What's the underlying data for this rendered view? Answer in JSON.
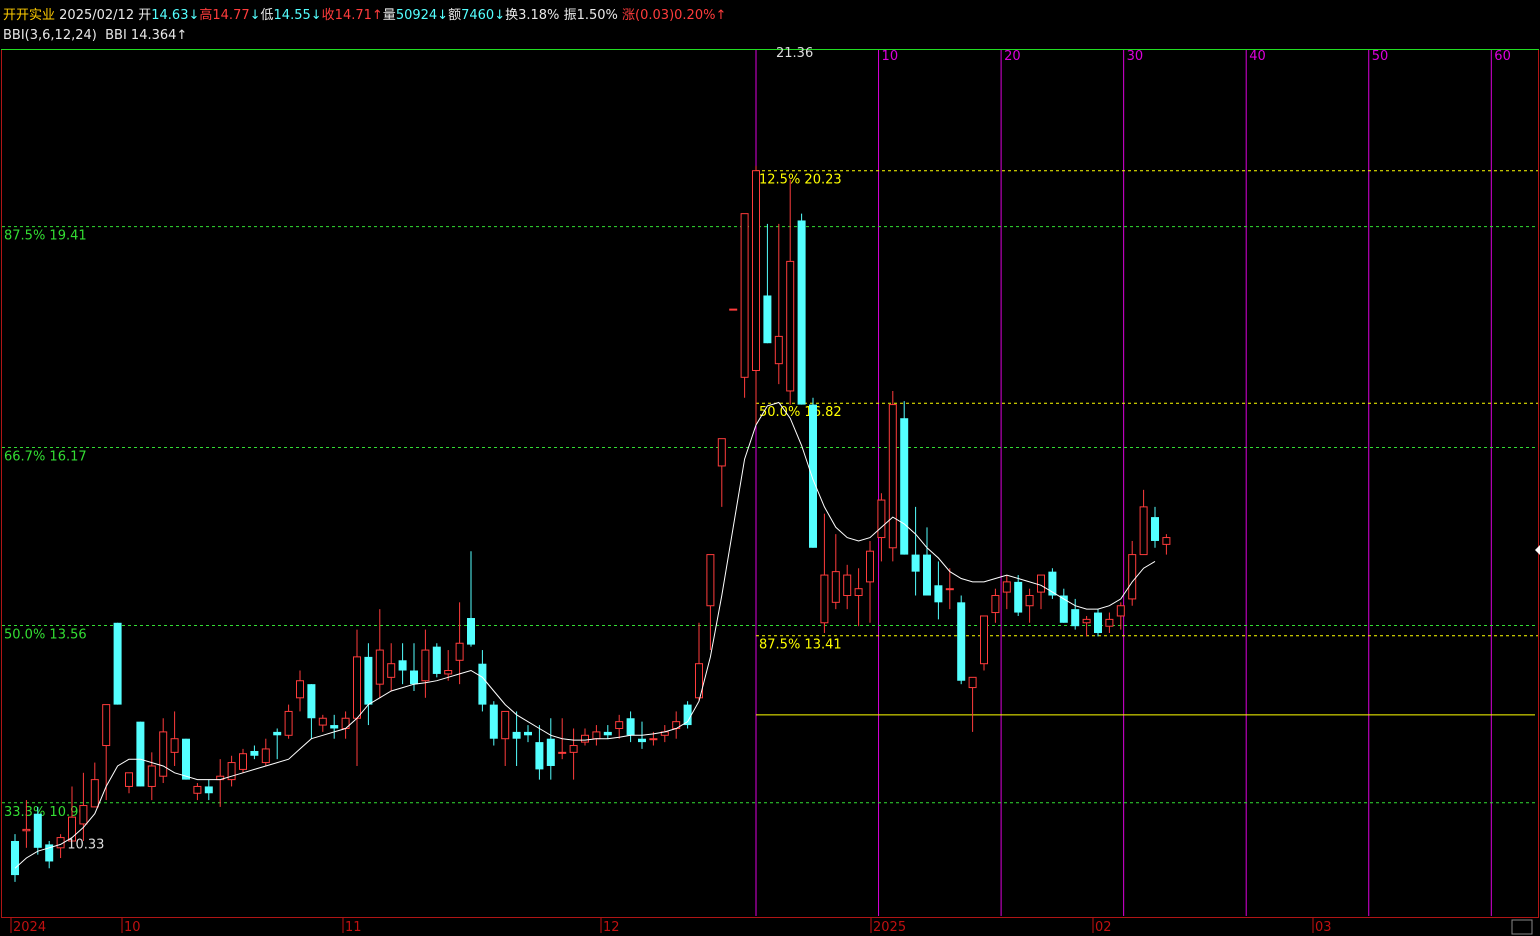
{
  "header": {
    "stock_name": "开开实业",
    "date": "2025/02/12",
    "open_label": "开",
    "open_value": "14.63",
    "open_arrow": "↓",
    "high_label": "高",
    "high_value": "14.77",
    "high_arrow": "↓",
    "low_label": "低",
    "low_value": "14.55",
    "low_arrow": "↓",
    "close_label": "收",
    "close_value": "14.71",
    "close_arrow": "↑",
    "volume_label": "量",
    "volume_value": "50924",
    "volume_arrow": "↓",
    "amount_label": "额",
    "amount_value": "7460",
    "amount_arrow": "↓",
    "turnover_label": "换",
    "turnover_value": "3.18%",
    "amplitude_label": "振",
    "amplitude_value": "1.50%",
    "change_label": "涨",
    "change_value": "(0.03)",
    "change_pct": "0.20%",
    "change_arrow": "↑"
  },
  "indicator": {
    "name": "BBI(3,6,12,24)",
    "series_label": "BBI",
    "value": "14.364",
    "arrow": "↑"
  },
  "colors": {
    "up": "#ff3c3c",
    "down": "#54ffff",
    "bbi_line": "#ffffff",
    "ratio_left": "#33dd33",
    "ratio_right": "#ffff00",
    "time_cycle": "#dd00dd",
    "axis_red": "#c01010",
    "text_yellow": "#ffcc00"
  },
  "chart_data": {
    "type": "candlestick",
    "y_range": [
      9.3,
      22.0
    ],
    "price_markers": {
      "high_marker": "21.36",
      "low_marker": "10.33"
    },
    "candles": [
      [
        10.4,
        10.5,
        9.8,
        9.9
      ],
      [
        10.55,
        11.0,
        10.3,
        10.57
      ],
      [
        10.8,
        10.9,
        10.2,
        10.3
      ],
      [
        10.35,
        10.4,
        10.0,
        10.1
      ],
      [
        10.3,
        10.5,
        10.15,
        10.45
      ],
      [
        10.4,
        11.2,
        10.4,
        10.75
      ],
      [
        10.65,
        11.4,
        10.4,
        10.92
      ],
      [
        10.9,
        11.55,
        10.9,
        11.3
      ],
      [
        11.8,
        12.4,
        11.0,
        12.4
      ],
      [
        13.6,
        13.6,
        12.4,
        12.4
      ],
      [
        11.2,
        11.4,
        11.1,
        11.4
      ],
      [
        12.15,
        12.15,
        11.2,
        11.2
      ],
      [
        11.2,
        11.7,
        11.0,
        11.5
      ],
      [
        11.35,
        12.2,
        11.25,
        12.0
      ],
      [
        11.7,
        12.3,
        11.5,
        11.9
      ],
      [
        11.9,
        11.9,
        11.3,
        11.3
      ],
      [
        11.1,
        11.25,
        11.0,
        11.2
      ],
      [
        11.2,
        11.3,
        11.0,
        11.1
      ],
      [
        11.3,
        11.6,
        10.9,
        11.35
      ],
      [
        11.3,
        11.65,
        11.2,
        11.55
      ],
      [
        11.45,
        11.75,
        11.4,
        11.68
      ],
      [
        11.72,
        11.8,
        11.6,
        11.65
      ],
      [
        11.55,
        11.9,
        11.5,
        11.75
      ],
      [
        12.0,
        12.05,
        11.6,
        11.95
      ],
      [
        11.95,
        12.4,
        11.9,
        12.3
      ],
      [
        12.5,
        12.9,
        12.3,
        12.75
      ],
      [
        12.7,
        12.7,
        11.9,
        12.2
      ],
      [
        12.1,
        12.25,
        12.0,
        12.2
      ],
      [
        12.1,
        12.25,
        11.9,
        12.05
      ],
      [
        12.05,
        12.3,
        11.9,
        12.2
      ],
      [
        12.2,
        13.5,
        11.5,
        13.1
      ],
      [
        13.1,
        13.3,
        12.1,
        12.4
      ],
      [
        12.7,
        13.8,
        12.5,
        13.2
      ],
      [
        12.8,
        13.3,
        12.6,
        13.0
      ],
      [
        13.05,
        13.3,
        12.7,
        12.9
      ],
      [
        12.9,
        13.3,
        12.6,
        12.7
      ],
      [
        12.75,
        13.5,
        12.5,
        13.2
      ],
      [
        13.25,
        13.3,
        12.8,
        12.85
      ],
      [
        12.85,
        13.2,
        12.75,
        12.9
      ],
      [
        13.05,
        13.9,
        12.7,
        13.3
      ],
      [
        13.67,
        14.65,
        13.25,
        13.28
      ],
      [
        13.0,
        13.2,
        12.3,
        12.4
      ],
      [
        12.4,
        12.45,
        11.8,
        11.9
      ],
      [
        11.9,
        12.3,
        11.5,
        12.3
      ],
      [
        12.0,
        12.3,
        11.5,
        11.9
      ],
      [
        12.0,
        12.1,
        11.85,
        11.95
      ],
      [
        11.85,
        12.1,
        11.3,
        11.45
      ],
      [
        11.9,
        12.2,
        11.3,
        11.5
      ],
      [
        11.7,
        12.2,
        11.6,
        11.7
      ],
      [
        11.7,
        12.05,
        11.3,
        11.8
      ],
      [
        11.85,
        12.05,
        11.8,
        11.95
      ],
      [
        11.9,
        12.1,
        11.8,
        12.0
      ],
      [
        12.0,
        12.1,
        11.9,
        11.95
      ],
      [
        12.05,
        12.25,
        11.9,
        12.15
      ],
      [
        12.2,
        12.3,
        11.85,
        11.95
      ],
      [
        11.9,
        12.15,
        11.75,
        11.85
      ],
      [
        11.9,
        12.0,
        11.8,
        11.9
      ],
      [
        11.95,
        12.1,
        11.85,
        12.0
      ],
      [
        12.05,
        12.3,
        11.9,
        12.15
      ],
      [
        12.4,
        12.45,
        12.05,
        12.1
      ],
      [
        12.5,
        13.6,
        12.45,
        13.0
      ],
      [
        13.85,
        14.5,
        13.2,
        14.6
      ],
      [
        15.9,
        16.3,
        15.3,
        16.3
      ],
      [
        18.2,
        18.2,
        18.2,
        18.2
      ],
      [
        17.2,
        19.4,
        16.9,
        19.6
      ],
      [
        17.3,
        20.3,
        16.5,
        20.23
      ],
      [
        18.4,
        19.45,
        17.7,
        17.7
      ],
      [
        17.4,
        19.45,
        17.1,
        17.8
      ],
      [
        17.0,
        20.1,
        16.8,
        18.9
      ],
      [
        19.5,
        19.6,
        16.8,
        16.8
      ],
      [
        16.8,
        16.9,
        14.7,
        14.7
      ],
      [
        13.6,
        15.2,
        13.45,
        14.3
      ],
      [
        13.9,
        14.9,
        13.8,
        14.35
      ],
      [
        14.0,
        14.45,
        13.8,
        14.3
      ],
      [
        14.0,
        14.4,
        13.55,
        14.1
      ],
      [
        14.2,
        14.8,
        13.6,
        14.65
      ],
      [
        14.85,
        15.5,
        14.5,
        15.4
      ],
      [
        14.7,
        17.0,
        14.5,
        16.8
      ],
      [
        16.6,
        16.85,
        14.6,
        14.6
      ],
      [
        14.6,
        15.3,
        14.0,
        14.35
      ],
      [
        14.6,
        15.0,
        14.0,
        14.0
      ],
      [
        14.15,
        14.5,
        13.65,
        13.9
      ],
      [
        14.1,
        14.4,
        13.8,
        14.1
      ],
      [
        13.9,
        14.0,
        12.7,
        12.75
      ],
      [
        12.65,
        12.8,
        12.0,
        12.8
      ],
      [
        13.0,
        13.6,
        12.9,
        13.7
      ],
      [
        13.75,
        14.1,
        13.6,
        14.0
      ],
      [
        14.05,
        14.3,
        13.8,
        14.2
      ],
      [
        14.2,
        14.3,
        13.7,
        13.75
      ],
      [
        13.85,
        14.1,
        13.6,
        14.0
      ],
      [
        14.05,
        14.3,
        13.8,
        14.3
      ],
      [
        14.35,
        14.4,
        13.95,
        14.0
      ],
      [
        14.0,
        14.1,
        13.6,
        13.6
      ],
      [
        13.8,
        13.95,
        13.5,
        13.55
      ],
      [
        13.6,
        13.7,
        13.4,
        13.65
      ],
      [
        13.75,
        13.8,
        13.4,
        13.45
      ],
      [
        13.55,
        13.75,
        13.45,
        13.65
      ],
      [
        13.7,
        13.9,
        13.5,
        13.85
      ],
      [
        13.95,
        14.8,
        13.85,
        14.6
      ],
      [
        14.6,
        15.55,
        14.6,
        15.3
      ],
      [
        15.15,
        15.3,
        14.7,
        14.8
      ],
      [
        14.75,
        14.9,
        14.6,
        14.85
      ]
    ],
    "bbi": [
      10.0,
      10.15,
      10.25,
      10.3,
      10.35,
      10.45,
      10.6,
      10.8,
      11.2,
      11.5,
      11.6,
      11.6,
      11.55,
      11.5,
      11.4,
      11.35,
      11.3,
      11.3,
      11.3,
      11.35,
      11.4,
      11.45,
      11.5,
      11.55,
      11.6,
      11.75,
      11.9,
      11.95,
      12.0,
      12.05,
      12.2,
      12.4,
      12.5,
      12.6,
      12.65,
      12.7,
      12.72,
      12.75,
      12.8,
      12.85,
      12.9,
      12.8,
      12.6,
      12.4,
      12.25,
      12.15,
      12.05,
      11.95,
      11.9,
      11.88,
      11.88,
      11.9,
      11.9,
      11.92,
      11.95,
      11.95,
      11.97,
      12.0,
      12.05,
      12.15,
      12.45,
      13.1,
      14.0,
      15.0,
      16.0,
      16.5,
      16.78,
      16.83,
      16.6,
      16.2,
      15.7,
      15.3,
      15.0,
      14.85,
      14.8,
      14.85,
      15.0,
      15.15,
      15.05,
      14.9,
      14.7,
      14.55,
      14.35,
      14.25,
      14.2,
      14.2,
      14.25,
      14.3,
      14.25,
      14.2,
      14.15,
      14.05,
      13.95,
      13.85,
      13.8,
      13.8,
      13.85,
      13.95,
      14.2,
      14.4,
      14.5
    ],
    "left_ratio_lines": [
      {
        "label": "87.5% 19.41",
        "price": 19.41
      },
      {
        "label": "66.7% 16.17",
        "price": 16.17
      },
      {
        "label": "50.0% 13.56",
        "price": 13.56
      },
      {
        "label": "33.3% 10.96",
        "price": 10.96
      }
    ],
    "right_ratio_lines": [
      {
        "label": "12.5% 20.23",
        "price": 20.23
      },
      {
        "label": "50.0% 16.82",
        "price": 16.82
      },
      {
        "label": "87.5% 13.41",
        "price": 13.41
      }
    ],
    "right_base_price": 12.25,
    "time_cycle_labels": [
      "10",
      "20",
      "30",
      "40",
      "50",
      "60"
    ],
    "x_axis_labels": [
      "2024",
      "10",
      "11",
      "12",
      "2025",
      "02",
      "03"
    ]
  }
}
